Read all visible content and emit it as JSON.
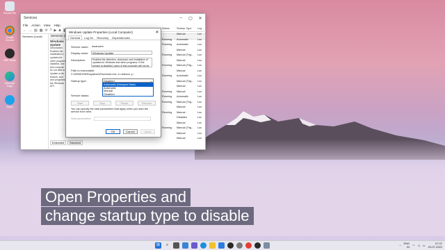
{
  "desktop": {
    "icons": [
      {
        "label": "Recycle Bin",
        "color": "#dfe7ef"
      },
      {
        "label": "Google Chrome",
        "color": "#e34133"
      },
      {
        "label": "OBS Studio",
        "color": "#2a2a2a"
      },
      {
        "label": "Microsoft Edge",
        "color": "#1d8fe1"
      },
      {
        "label": "Skype",
        "color": "#1aa3ea"
      }
    ]
  },
  "services_window": {
    "title": "Services",
    "menu": [
      "File",
      "Action",
      "View",
      "Help"
    ],
    "left_node": "Services (Local)",
    "pane_head": "Services (Local)",
    "pane_subtitle": "Windows Update",
    "description_lines": [
      "Description:",
      "Enables the",
      "installation o",
      "updates for",
      "other program",
      "disabled, use",
      "this compute",
      "be not able to",
      "Update or its",
      "feature, and",
      "and programs",
      "the Windows",
      "API."
    ],
    "table_headers": [
      "Status",
      "Startup Type",
      "Log"
    ],
    "rows": [
      [
        "",
        "Manual",
        "Loc"
      ],
      [
        "Running",
        "Automatic",
        "Loc"
      ],
      [
        "Running",
        "Automatic",
        "Loc"
      ],
      [
        "",
        "Manual",
        "Loc"
      ],
      [
        "Running",
        "Manual (Trig...",
        "Loc"
      ],
      [
        "",
        "Manual",
        "Loc"
      ],
      [
        "Running",
        "Manual (Trig...",
        "Loc"
      ],
      [
        "",
        "Manual",
        "Loc"
      ],
      [
        "Running",
        "Automatic",
        "Loc"
      ],
      [
        "",
        "Manual (Trig...",
        "Loc"
      ],
      [
        "",
        "Manual",
        "Loc"
      ],
      [
        "Running",
        "Manual",
        "Loc"
      ],
      [
        "Running",
        "Automatic",
        "Loc"
      ],
      [
        "Running",
        "Manual (Trig...",
        "Loc"
      ],
      [
        "",
        "Manual",
        "Loc"
      ],
      [
        "Running",
        "Manual",
        "Loc"
      ],
      [
        "",
        "Disabled",
        "Loc"
      ],
      [
        "",
        "Manual",
        "Loc"
      ],
      [
        "Running",
        "Manual (Trig...",
        "Loc"
      ],
      [
        "",
        "Manual",
        "Loc"
      ],
      [
        "",
        "Manual",
        "Loc"
      ]
    ],
    "bottom_tabs": [
      "Extended",
      "Standard"
    ]
  },
  "dialog": {
    "title": "Windows Update Properties (Local Computer)",
    "tabs": [
      "General",
      "Log On",
      "Recovery",
      "Dependencies"
    ],
    "service_name_label": "Service name:",
    "service_name": "wuauserv",
    "display_name_label": "Display name:",
    "display_name": "Windows Update",
    "description_label": "Description:",
    "description": "Enables the detection, download, and installation of updates for Windows and other programs. If this service is disabled, users of this computer will not be",
    "path_label": "Path to executable:",
    "path": "C:\\WINDOWS\\system32\\svchost.exe -k netsvcs -p",
    "startup_label": "Startup type:",
    "startup_value": "Disabled",
    "dropdown_options": [
      "Automatic (Delayed Start)",
      "Automatic",
      "Manual",
      "Disabled"
    ],
    "selected_option_index": 0,
    "status_label": "Service status:",
    "buttons": [
      "Start",
      "Stop",
      "Pause",
      "Resume"
    ],
    "hint": "You can specify the start parameters that apply when you start the service from here.",
    "params_label": "Start parameters:",
    "ok": "OK",
    "cancel": "Cancel",
    "apply": "Apply"
  },
  "caption": {
    "line1": "Open Properties and",
    "line2": "change startup type to disable"
  },
  "taskbar": {
    "lang": "ENG",
    "region": "IN",
    "time": "07:37",
    "date": "20-07-2022"
  }
}
